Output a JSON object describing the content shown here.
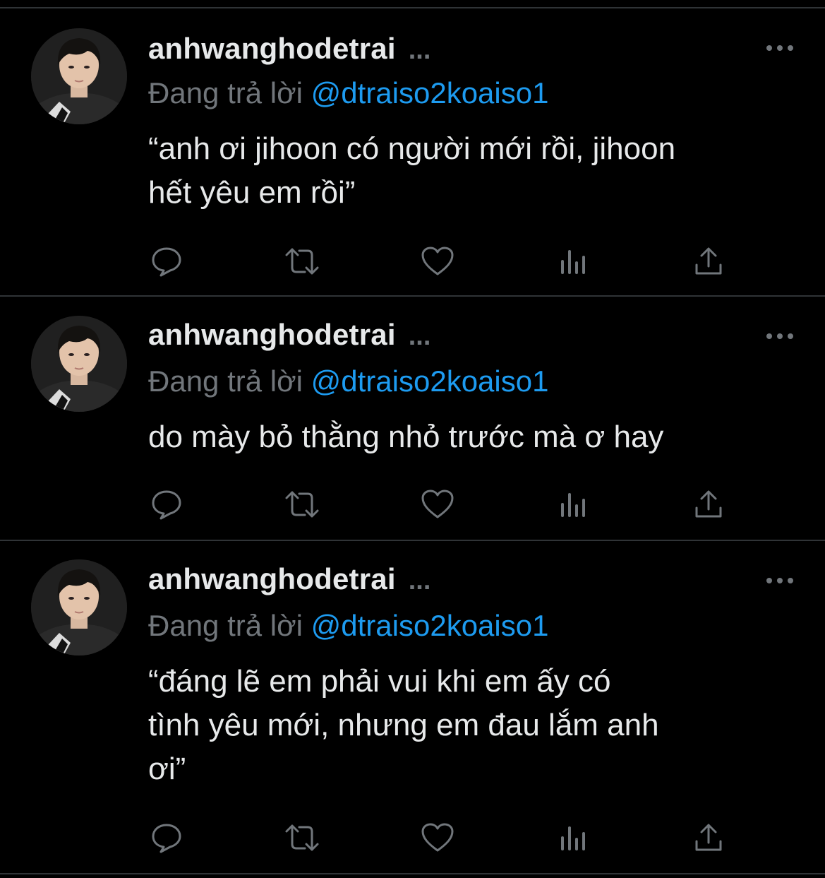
{
  "colors": {
    "background": "#000000",
    "text": "#e7e9ea",
    "secondary": "#71767b",
    "link": "#1d9bf0",
    "divider": "#2f3336"
  },
  "tweets": [
    {
      "username": "anhwanghodetrai",
      "username_more": "...",
      "reply_prefix": "Đang trả lời",
      "reply_handle": "@dtraiso2koaiso1",
      "text": "“anh ơi jihoon có người mới rồi, jihoon\nhết yêu em rồi”",
      "actions": [
        "reply-icon",
        "retweet-icon",
        "like-icon",
        "views-icon",
        "share-icon"
      ]
    },
    {
      "username": "anhwanghodetrai",
      "username_more": "...",
      "reply_prefix": "Đang trả lời",
      "reply_handle": "@dtraiso2koaiso1",
      "text": "do mày bỏ thằng nhỏ trước mà ơ hay",
      "actions": [
        "reply-icon",
        "retweet-icon",
        "like-icon",
        "views-icon",
        "share-icon"
      ]
    },
    {
      "username": "anhwanghodetrai",
      "username_more": "...",
      "reply_prefix": "Đang trả lời",
      "reply_handle": "@dtraiso2koaiso1",
      "text": "“đáng lẽ em phải vui khi em ấy có\ntình yêu mới, nhưng em đau lắm anh\nơi”",
      "actions": [
        "reply-icon",
        "retweet-icon",
        "like-icon",
        "views-icon",
        "share-icon"
      ]
    }
  ]
}
